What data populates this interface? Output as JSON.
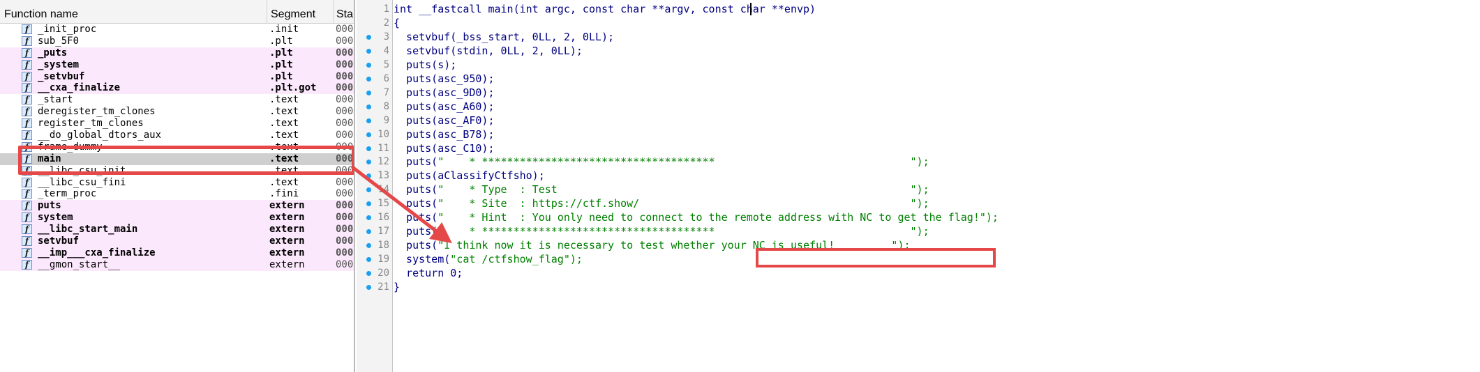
{
  "functions_panel": {
    "columns": {
      "name": "Function name",
      "segment": "Segment",
      "start": "Sta"
    },
    "rows": [
      {
        "name": "_init_proc",
        "segment": ".init",
        "start": "0000",
        "pink": false,
        "bold": false
      },
      {
        "name": "sub_5F0",
        "segment": ".plt",
        "start": "0000",
        "pink": false,
        "bold": false
      },
      {
        "name": "_puts",
        "segment": ".plt",
        "start": "000",
        "pink": true,
        "bold": true
      },
      {
        "name": "_system",
        "segment": ".plt",
        "start": "000",
        "pink": true,
        "bold": true
      },
      {
        "name": "_setvbuf",
        "segment": ".plt",
        "start": "000",
        "pink": true,
        "bold": true
      },
      {
        "name": "__cxa_finalize",
        "segment": ".plt.got",
        "start": "000",
        "pink": true,
        "bold": true
      },
      {
        "name": "_start",
        "segment": ".text",
        "start": "0000",
        "pink": false,
        "bold": false
      },
      {
        "name": "deregister_tm_clones",
        "segment": ".text",
        "start": "0000",
        "pink": false,
        "bold": false
      },
      {
        "name": "register_tm_clones",
        "segment": ".text",
        "start": "0000",
        "pink": false,
        "bold": false
      },
      {
        "name": "__do_global_dtors_aux",
        "segment": ".text",
        "start": "0000",
        "pink": false,
        "bold": false
      },
      {
        "name": "frame_dummy",
        "segment": ".text",
        "start": "0000",
        "pink": false,
        "bold": false
      },
      {
        "name": "main",
        "segment": ".text",
        "start": "000",
        "pink": false,
        "bold": true,
        "selected": true
      },
      {
        "name": "__libc_csu_init",
        "segment": ".text",
        "start": "0000",
        "pink": false,
        "bold": false
      },
      {
        "name": "__libc_csu_fini",
        "segment": ".text",
        "start": "0000",
        "pink": false,
        "bold": false
      },
      {
        "name": "_term_proc",
        "segment": ".fini",
        "start": "0000",
        "pink": false,
        "bold": false
      },
      {
        "name": "puts",
        "segment": "extern",
        "start": "000",
        "pink": true,
        "bold": true
      },
      {
        "name": "system",
        "segment": "extern",
        "start": "000",
        "pink": true,
        "bold": true
      },
      {
        "name": "__libc_start_main",
        "segment": "extern",
        "start": "000",
        "pink": true,
        "bold": true
      },
      {
        "name": "setvbuf",
        "segment": "extern",
        "start": "000",
        "pink": true,
        "bold": true
      },
      {
        "name": "__imp___cxa_finalize",
        "segment": "extern",
        "start": "000",
        "pink": true,
        "bold": true
      },
      {
        "name": "__gmon_start__",
        "segment": "extern",
        "start": "000",
        "pink": true,
        "bold": false
      }
    ]
  },
  "pseudocode": {
    "lines": [
      {
        "n": "1",
        "dot": false,
        "code": "int __fastcall main(int argc, const char **argv, const char **envp)",
        "str": ""
      },
      {
        "n": "2",
        "dot": false,
        "code": "{",
        "str": ""
      },
      {
        "n": "3",
        "dot": true,
        "code": "  setvbuf(_bss_start, 0LL, 2, 0LL);",
        "str": ""
      },
      {
        "n": "4",
        "dot": true,
        "code": "  setvbuf(stdin, 0LL, 2, 0LL);",
        "str": ""
      },
      {
        "n": "5",
        "dot": true,
        "code": "  puts(s);",
        "str": ""
      },
      {
        "n": "6",
        "dot": true,
        "code": "  puts(asc_950);",
        "str": ""
      },
      {
        "n": "7",
        "dot": true,
        "code": "  puts(asc_9D0);",
        "str": ""
      },
      {
        "n": "8",
        "dot": true,
        "code": "  puts(asc_A60);",
        "str": ""
      },
      {
        "n": "9",
        "dot": true,
        "code": "  puts(asc_AF0);",
        "str": ""
      },
      {
        "n": "10",
        "dot": true,
        "code": "  puts(asc_B78);",
        "str": ""
      },
      {
        "n": "11",
        "dot": true,
        "code": "  puts(asc_C10);",
        "str": ""
      },
      {
        "n": "12",
        "dot": true,
        "code": "  puts(",
        "str": "\"    * *************************************                               \");"
      },
      {
        "n": "13",
        "dot": true,
        "code": "  puts(aClassifyCtfsho);",
        "str": ""
      },
      {
        "n": "14",
        "dot": true,
        "code": "  puts(",
        "str": "\"    * Type  : Test                                                        \");"
      },
      {
        "n": "15",
        "dot": true,
        "code": "  puts(",
        "str": "\"    * Site  : https://ctf.show/                                           \");"
      },
      {
        "n": "16",
        "dot": true,
        "code": "  puts(",
        "str": "\"    * Hint  : You only need to connect to the remote address with NC to get the flag!\");"
      },
      {
        "n": "17",
        "dot": true,
        "code": "  puts(",
        "str": "\"    * *************************************                               \");"
      },
      {
        "n": "18",
        "dot": true,
        "code": "  puts(",
        "str": "\"I think now it is necessary to test whether your NC is useful!         \");"
      },
      {
        "n": "19",
        "dot": true,
        "code": "  system(",
        "str": "\"cat /ctfshow_flag\");"
      },
      {
        "n": "20",
        "dot": true,
        "code": "  return 0;",
        "str": ""
      },
      {
        "n": "21",
        "dot": true,
        "code": "}",
        "str": ""
      }
    ]
  }
}
